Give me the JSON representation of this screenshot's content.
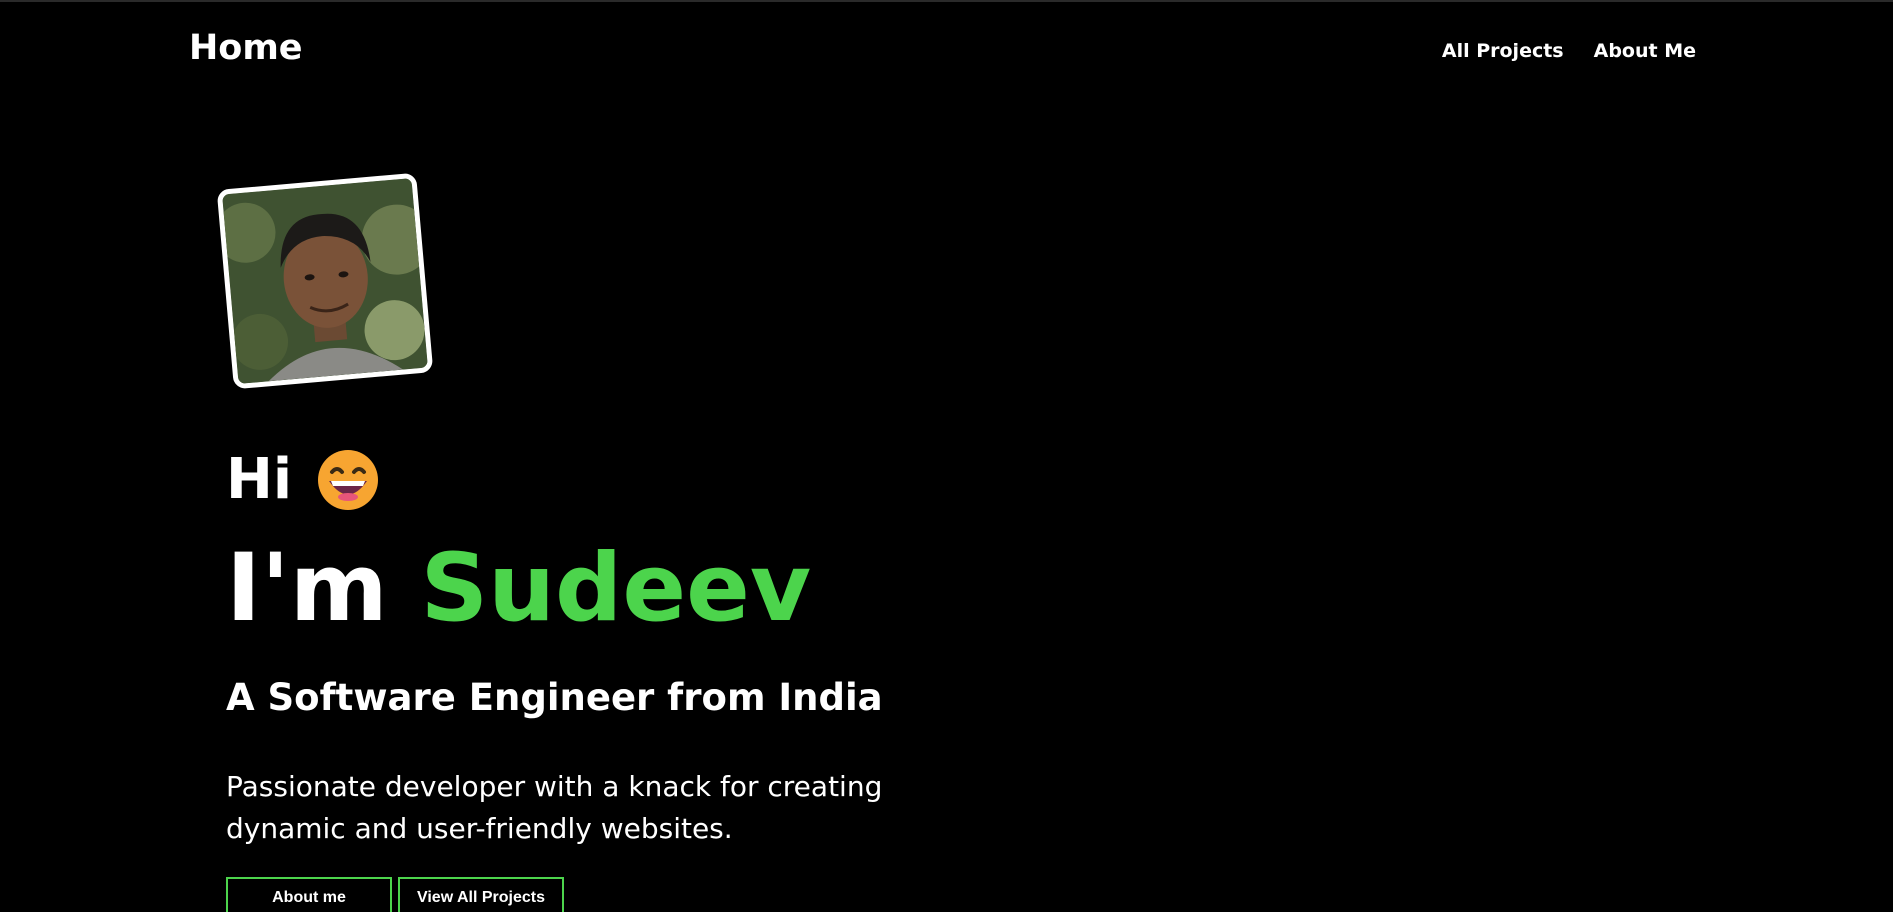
{
  "navbar": {
    "brand": "Home",
    "links": [
      {
        "label": "All Projects"
      },
      {
        "label": "About Me"
      }
    ]
  },
  "hero": {
    "greeting": "Hi",
    "greeting_icon": "grinning-face-emoji-icon",
    "intro_prefix": "I'm",
    "name": "Sudeev",
    "subtitle": "A Software Engineer from India",
    "description": "Passionate developer with a knack for creating dynamic and user-friendly websites.",
    "buttons": [
      {
        "label": "About me"
      },
      {
        "label": "View All Projects"
      }
    ]
  },
  "colors": {
    "background": "#000000",
    "text": "#ffffff",
    "accent": "#4cd44c",
    "emoji": "#f7a531"
  }
}
